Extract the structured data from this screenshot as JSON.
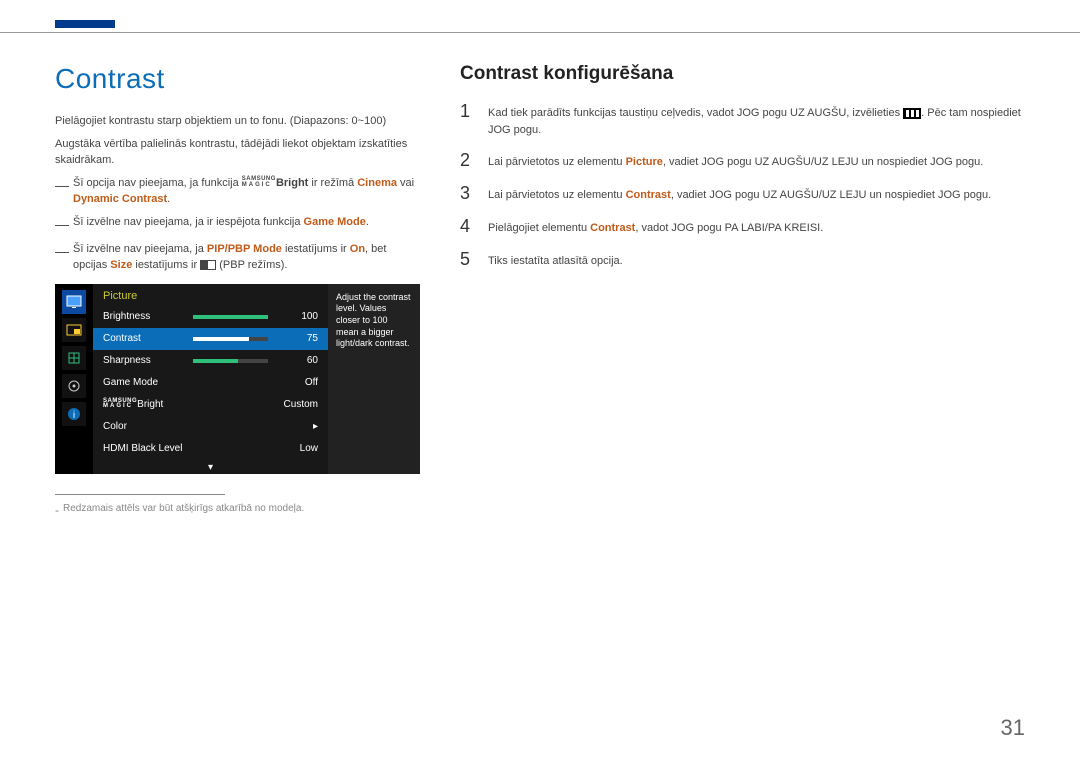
{
  "header": {
    "accent_color": "#003a8c"
  },
  "left": {
    "title": "Contrast",
    "p1": "Pielāgojiet kontrastu starp objektiem un to fonu. (Diapazons: 0~100)",
    "p2": "Augstāka vērtība palielinās kontrastu, tādējādi liekot objektam izskatīties skaidrākam.",
    "bullets": {
      "b1_pre": "Šī opcija nav pieejama, ja funkcija ",
      "brand_line1": "SAMSUNG",
      "brand_line2": "MAGIC",
      "bright": "Bright",
      "b1_mid": " ir režīmā ",
      "cinema": "Cinema",
      "b1_or": " vai ",
      "dynamic_contrast": "Dynamic Contrast",
      "period": ".",
      "b2_pre": "Šī izvēlne nav pieejama, ja ir iespējota funkcija ",
      "game_mode": "Game Mode",
      "b3_pre": "Šī izvēlne nav pieejama, ja ",
      "pip_pbp_mode": "PIP/PBP Mode",
      "b3_mid1": " iestatījums ir ",
      "on": "On",
      "b3_mid2": ", bet opcijas ",
      "size": "Size",
      "b3_mid3": " iestatījums ir ",
      "b3_end": " (PBP režīms)."
    },
    "footnote": "Redzamais attēls var būt atšķirīgs atkarībā no modeļa.",
    "osd": {
      "section_title": "Picture",
      "rows": {
        "brightness": {
          "label": "Brightness",
          "value": 100
        },
        "contrast": {
          "label": "Contrast",
          "value": 75
        },
        "sharpness": {
          "label": "Sharpness",
          "value": 60
        },
        "game_mode": {
          "label": "Game Mode",
          "value": "Off"
        },
        "magic_bright": {
          "label_suffix": "Bright",
          "value": "Custom"
        },
        "color": {
          "label": "Color",
          "value": "▸"
        },
        "hdmi_black": {
          "label": "HDMI Black Level",
          "value": "Low"
        }
      },
      "footer_arrow": "▾",
      "help": "Adjust the contrast level. Values closer to 100 mean a bigger light/dark contrast."
    }
  },
  "right": {
    "title": "Contrast konfigurēšana",
    "steps": {
      "s1_num": "1",
      "s1_pre": "Kad tiek parādīts funkcijas taustiņu ceļvedis, vadot JOG pogu UZ AUGŠU, izvēlieties ",
      "s1_post": ". Pēc tam nospiediet JOG pogu.",
      "s2_num": "2",
      "s2_pre": "Lai pārvietotos uz elementu ",
      "picture": "Picture",
      "s2_post": ", vadiet JOG pogu UZ AUGŠU/UZ LEJU un nospiediet JOG pogu.",
      "s3_num": "3",
      "s3_pre": "Lai pārvietotos uz elementu ",
      "contrast": "Contrast",
      "s3_post": ", vadiet JOG pogu UZ AUGŠU/UZ LEJU un nospiediet JOG pogu.",
      "s4_num": "4",
      "s4_pre": "Pielāgojiet elementu ",
      "s4_post": ", vadot JOG pogu PA LABI/PA KREISI.",
      "s5_num": "5",
      "s5_text": "Tiks iestatīta atlasītā opcija."
    }
  },
  "page_number": "31"
}
